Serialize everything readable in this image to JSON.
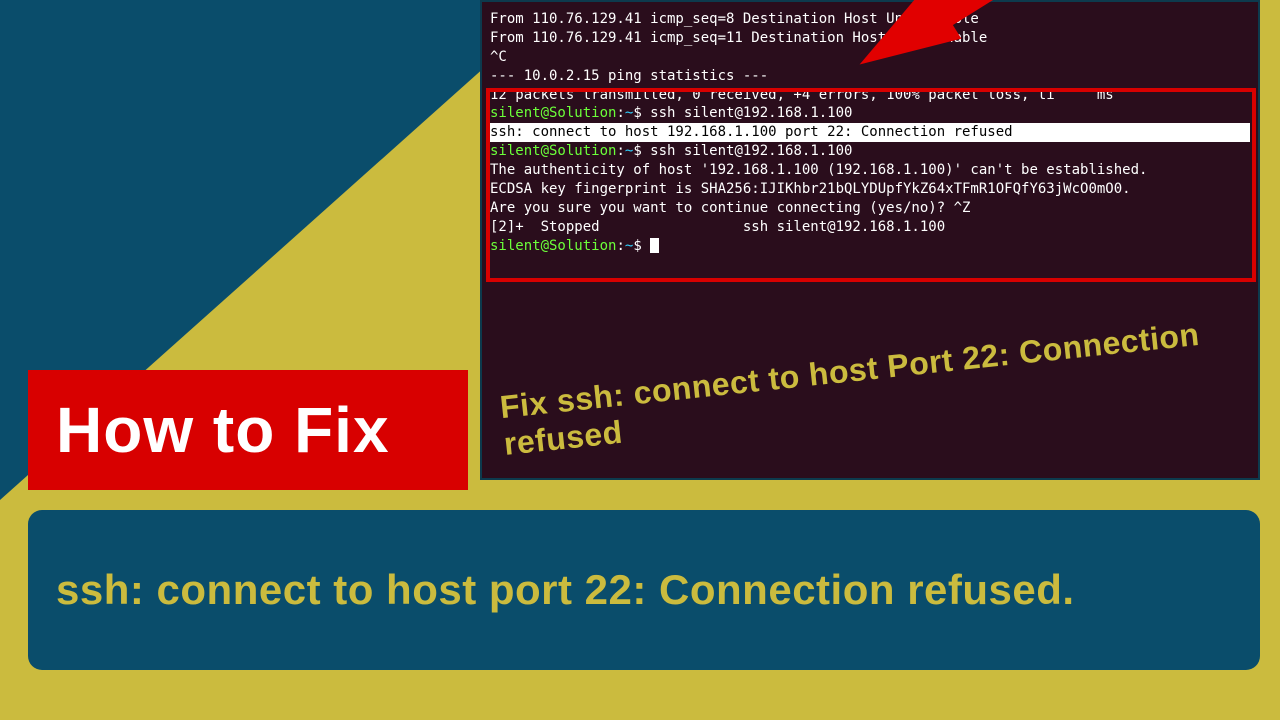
{
  "colors": {
    "yellow": "#cbbb3e",
    "teal": "#0a4d6b",
    "red": "#d80000",
    "terminal_bg": "#2a0d1c"
  },
  "terminal": {
    "lines": [
      {
        "segments": [
          {
            "cls": "term-white",
            "text": "From 110.76.129.41 icmp_seq=8 Destination Host Unreachable"
          }
        ]
      },
      {
        "segments": [
          {
            "cls": "term-white",
            "text": "From 110.76.129.41 icmp_seq=11 Destination Host Unreachable"
          }
        ]
      },
      {
        "segments": [
          {
            "cls": "term-white",
            "text": "^C"
          }
        ]
      },
      {
        "segments": [
          {
            "cls": "term-white",
            "text": "--- 10.0.2.15 ping statistics ---"
          }
        ]
      },
      {
        "segments": [
          {
            "cls": "term-white",
            "text": "12 packets transmitted, 0 received, +4 errors, 100% packet loss, ti     ms"
          }
        ]
      },
      {
        "segments": [
          {
            "cls": "term-white",
            "text": ""
          }
        ]
      },
      {
        "segments": [
          {
            "cls": "term-green",
            "text": "silent@Solution"
          },
          {
            "cls": "term-white",
            "text": ":"
          },
          {
            "cls": "term-cyan",
            "text": "~"
          },
          {
            "cls": "term-white",
            "text": "$ ssh silent@192.168.1.100"
          }
        ]
      },
      {
        "highlight": true,
        "segments": [
          {
            "cls": "",
            "text": "ssh: connect to host 192.168.1.100 port 22: Connection refused"
          }
        ]
      },
      {
        "segments": [
          {
            "cls": "term-green",
            "text": "silent@Solution"
          },
          {
            "cls": "term-white",
            "text": ":"
          },
          {
            "cls": "term-cyan",
            "text": "~"
          },
          {
            "cls": "term-white",
            "text": "$ ssh silent@192.168.1.100"
          }
        ]
      },
      {
        "segments": [
          {
            "cls": "term-white",
            "text": "The authenticity of host '192.168.1.100 (192.168.1.100)' can't be established."
          }
        ]
      },
      {
        "segments": [
          {
            "cls": "term-white",
            "text": "ECDSA key fingerprint is SHA256:IJIKhbr21bQLYDUpfYkZ64xTFmR1OFQfY63jWcO0mO0."
          }
        ]
      },
      {
        "segments": [
          {
            "cls": "term-white",
            "text": "Are you sure you want to continue connecting (yes/no)? ^Z"
          }
        ]
      },
      {
        "segments": [
          {
            "cls": "term-white",
            "text": "[2]+  Stopped                 ssh silent@192.168.1.100"
          }
        ]
      },
      {
        "segments": [
          {
            "cls": "term-green",
            "text": "silent@Solution"
          },
          {
            "cls": "term-white",
            "text": ":"
          },
          {
            "cls": "term-cyan",
            "text": "~"
          },
          {
            "cls": "term-white",
            "text": "$ "
          }
        ],
        "cursor": true
      }
    ]
  },
  "overlay_title": "Fix ssh: connect to host Port 22: Connection refused",
  "howto_label": "How to Fix",
  "subtitle": "ssh: connect to host port 22: Connection refused."
}
